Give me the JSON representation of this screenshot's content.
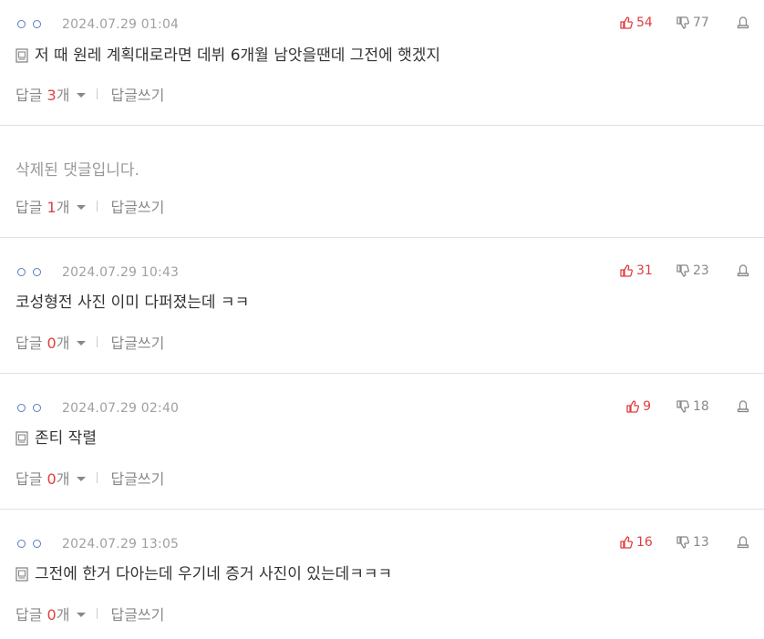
{
  "comments": [
    {
      "date": "2024.07.29 01:04",
      "text": "저 때 원레 계획대로라면 데뷔 6개월 남앗을땐데 그전에 햇겠지",
      "up": "54",
      "down": "77",
      "reply_label": "답글",
      "reply_count": "3",
      "reply_unit": "개",
      "write_label": "답글쓰기"
    },
    {
      "text": "삭제된 댓글입니다.",
      "reply_label": "답글",
      "reply_count": "1",
      "reply_unit": "개",
      "write_label": "답글쓰기"
    },
    {
      "date": "2024.07.29 10:43",
      "text": "코성형전 사진 이미 다퍼졌는데 ㅋㅋ",
      "up": "31",
      "down": "23",
      "reply_label": "답글",
      "reply_count": "0",
      "reply_unit": "개",
      "write_label": "답글쓰기"
    },
    {
      "date": "2024.07.29 02:40",
      "text": "존티 작렬",
      "up": "9",
      "down": "18",
      "reply_label": "답글",
      "reply_count": "0",
      "reply_unit": "개",
      "write_label": "답글쓰기"
    },
    {
      "date": "2024.07.29 13:05",
      "text": "그전에 한거 다아는데 우기네 증거 사진이 있는데ㅋㅋㅋ",
      "up": "16",
      "down": "13",
      "reply_label": "답글",
      "reply_count": "0",
      "reply_unit": "개",
      "write_label": "답글쓰기"
    }
  ],
  "icons": {
    "nickname": "nickname-icon",
    "upvote": "thumbs-up-icon",
    "downvote": "thumbs-down-icon",
    "report": "report-icon",
    "document": "document-icon"
  },
  "colors": {
    "accent_red": "#e03e3e",
    "meta_gray": "#a0a0a0",
    "text": "#333333",
    "divider": "#e1e1e1"
  }
}
